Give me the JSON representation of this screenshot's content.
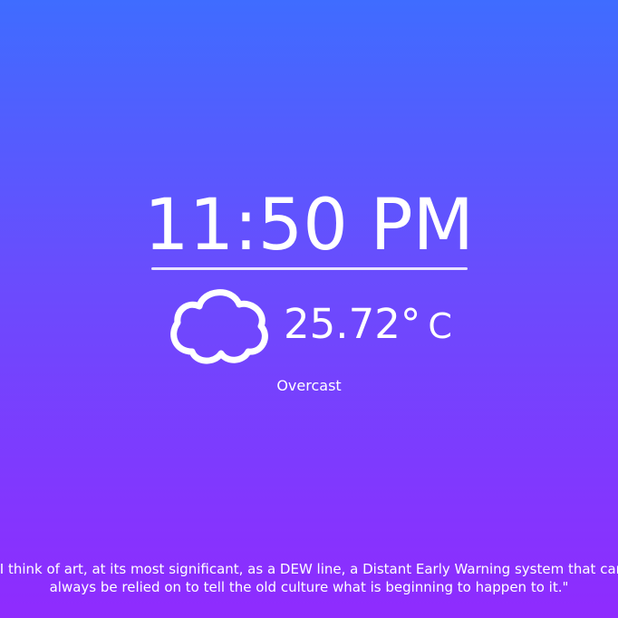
{
  "clock": {
    "time": "11:50 PM"
  },
  "weather": {
    "icon": "cloud-icon",
    "temperature": "25.72°",
    "unit": "C",
    "condition": "Overcast"
  },
  "quote": {
    "text": "\"I think of art, at its most significant, as a DEW line, a Distant Early Warning system that can always be relied on to tell the old culture what is beginning to happen to it.\""
  },
  "colors": {
    "gradient_top": "#3f6cff",
    "gradient_bottom": "#8f2bfe",
    "text": "#ffffff"
  }
}
